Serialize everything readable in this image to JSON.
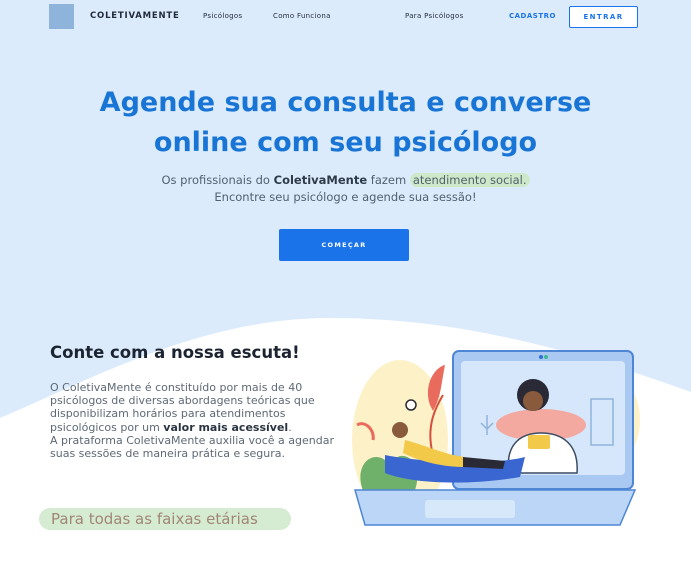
{
  "nav": {
    "brand": "COLETIVAMENTE",
    "links": [
      "Psicólogos",
      "Como Funciona",
      "Para Psicólogos"
    ],
    "cadastro": "CADASTRO",
    "entrar": "ENTRAR"
  },
  "hero": {
    "title_line1": "Agende sua consulta e converse",
    "title_line2": "online com seu psicólogo",
    "sub_part1": "Os profissionais do ",
    "sub_brand": "ColetivaMente",
    "sub_part2": " fazem ",
    "sub_highlight": "atendimento social.",
    "sub_line2": "Encontre seu psicólogo e agende sua sessão!",
    "cta": "COMEÇAR"
  },
  "section": {
    "title": "Conte com a nossa escuta!",
    "p1_part1": "O ColetivaMente é constituído por mais de 40 psicólogos de diversas abordagens teóricas que disponibilizam horários para atendimentos psicológicos por um ",
    "p1_strong": "valor mais acessível",
    "p1_end": ".",
    "p2": "A prataforma ColetivaMente auxilia você a agendar suas sessões de maneira prática e segura.",
    "age_label": "Para todas as faixas etárias"
  },
  "colors": {
    "accent": "#1a73e8",
    "hero_bg": "#dcebfc",
    "title": "#1875d6",
    "highlight_green": "#cde9c9"
  },
  "icons": {
    "illustration": "online-therapy-laptop-illustration"
  }
}
